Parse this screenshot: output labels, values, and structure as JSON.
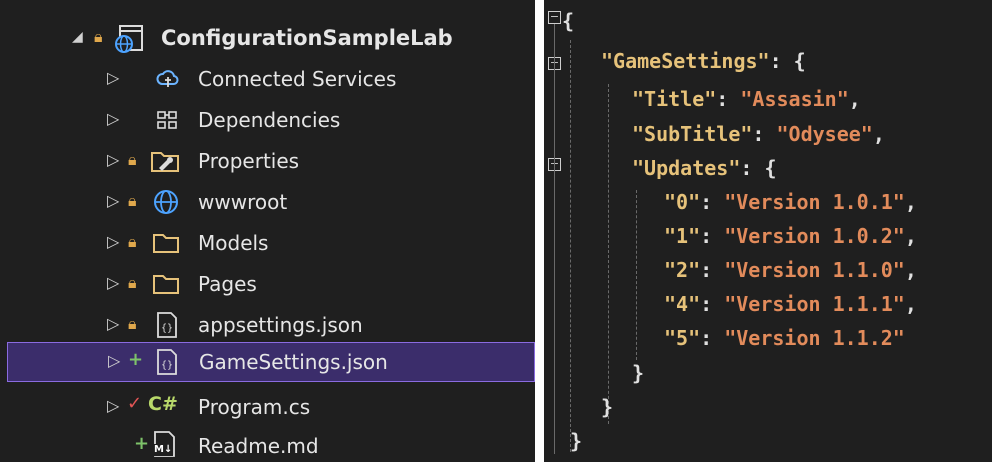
{
  "explorer": {
    "project": "ConfigurationSampleLab",
    "items": [
      {
        "label": "Connected Services",
        "icon": "connected-services-icon"
      },
      {
        "label": "Dependencies",
        "icon": "dependencies-icon"
      },
      {
        "label": "Properties",
        "icon": "properties-folder-icon"
      },
      {
        "label": "wwwroot",
        "icon": "globe-icon"
      },
      {
        "label": "Models",
        "icon": "folder-icon"
      },
      {
        "label": "Pages",
        "icon": "folder-icon"
      },
      {
        "label": "appsettings.json",
        "icon": "json-file-icon"
      },
      {
        "label": "GameSettings.json",
        "icon": "json-file-icon"
      },
      {
        "label": "Program.cs",
        "icon": "csharp-file-icon"
      },
      {
        "label": "Readme.md",
        "icon": "markdown-file-icon"
      }
    ],
    "csharp_glyph": "C#",
    "markdown_glyph": "M↓"
  },
  "editor": {
    "open_brace": "{",
    "close_brace": "}",
    "game_settings_key": "\"GameSettings\"",
    "title_key": "\"Title\"",
    "title_value": "\"Assasin\"",
    "subtitle_key": "\"SubTitle\"",
    "subtitle_value": "\"Odysee\"",
    "updates_key": "\"Updates\"",
    "updates": [
      {
        "key": "\"0\"",
        "value": "\"Version 1.0.1\""
      },
      {
        "key": "\"1\"",
        "value": "\"Version 1.0.2\""
      },
      {
        "key": "\"2\"",
        "value": "\"Version 1.1.0\""
      },
      {
        "key": "\"4\"",
        "value": "\"Version 1.1.1\""
      },
      {
        "key": "\"5\"",
        "value": "\"Version 1.1.2\""
      }
    ]
  },
  "colors": {
    "background": "#1f1f1f",
    "selection": "#3b2d6b",
    "json_key": "#e6c27a",
    "json_string": "#e28b5b",
    "lock": "#e0a84c"
  }
}
